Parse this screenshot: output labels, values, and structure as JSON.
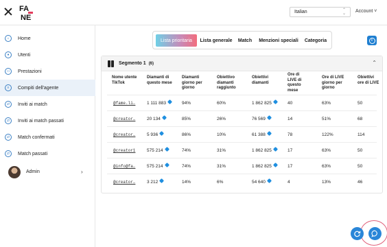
{
  "header": {
    "logo_text": "FA NE",
    "language": "Italian",
    "account_label": "Account"
  },
  "sidebar": {
    "items": [
      {
        "label": "Home",
        "icon": "home-icon"
      },
      {
        "label": "Utenti",
        "icon": "users-icon"
      },
      {
        "label": "Prestazioni",
        "icon": "performance-icon"
      },
      {
        "label": "Compiti dell'agente",
        "icon": "tasks-icon",
        "active": true
      },
      {
        "label": "Inviti ai match",
        "icon": "invite-icon"
      },
      {
        "label": "Inviti ai match passati",
        "icon": "invite-icon"
      },
      {
        "label": "Match confermati",
        "icon": "match-icon"
      },
      {
        "label": "Match passati",
        "icon": "match-icon"
      }
    ],
    "user": {
      "name": "Admin"
    }
  },
  "tabs": [
    {
      "label": "Lista prioritaria",
      "active": true
    },
    {
      "label": "Lista generale",
      "active": false
    },
    {
      "label": "Match",
      "active": false
    },
    {
      "label": "Menzioni speciali",
      "active": false
    },
    {
      "label": "Categoria",
      "active": false
    }
  ],
  "segment": {
    "title": "Segmento 1",
    "count": "(6)"
  },
  "table": {
    "columns": [
      "Nome utente TikTok",
      "Diamanti di questo mese",
      "Diamanti giorno per giorno",
      "Obiettivo diamanti raggiunto",
      "Obiettivi diamanti",
      "Ore di LIVE di questo mese",
      "Ore di LIVE giorno per giorno",
      "Obiettivi ore di LIVE"
    ],
    "rows": [
      {
        "user": "@fame.li…",
        "diamonds": "1 111 883",
        "daily": "94%",
        "reached": "60%",
        "target": "1 862 825",
        "live_hours": "40",
        "live_daily": "63%",
        "live_target": "50"
      },
      {
        "user": "@creator…",
        "diamonds": "20 134",
        "daily": "85%",
        "reached": "26%",
        "target": "76 569",
        "live_hours": "14",
        "live_daily": "51%",
        "live_target": "68"
      },
      {
        "user": "@creator…",
        "diamonds": "5 936",
        "daily": "86%",
        "reached": "10%",
        "target": "61 388",
        "live_hours": "78",
        "live_daily": "122%",
        "live_target": "114"
      },
      {
        "user": "@creator1",
        "diamonds": "575 214",
        "daily": "74%",
        "reached": "31%",
        "target": "1 862 825",
        "live_hours": "17",
        "live_daily": "63%",
        "live_target": "50"
      },
      {
        "user": "@info@fa…",
        "diamonds": "575 214",
        "daily": "74%",
        "reached": "31%",
        "target": "1 862 825",
        "live_hours": "17",
        "live_daily": "63%",
        "live_target": "50"
      },
      {
        "user": "@creator…",
        "diamonds": "3 212",
        "daily": "14%",
        "reached": "6%",
        "target": "54 640",
        "live_hours": "4",
        "live_daily": "13%",
        "live_target": "46"
      }
    ]
  },
  "colors": {
    "accent": "#1f7fd1",
    "active_tab_gradient": [
      "#6fd0e6",
      "#c78ab8",
      "#f26d7d"
    ],
    "nav_active_bg": "#eaf1f9",
    "gem": "#1f8fe0"
  }
}
